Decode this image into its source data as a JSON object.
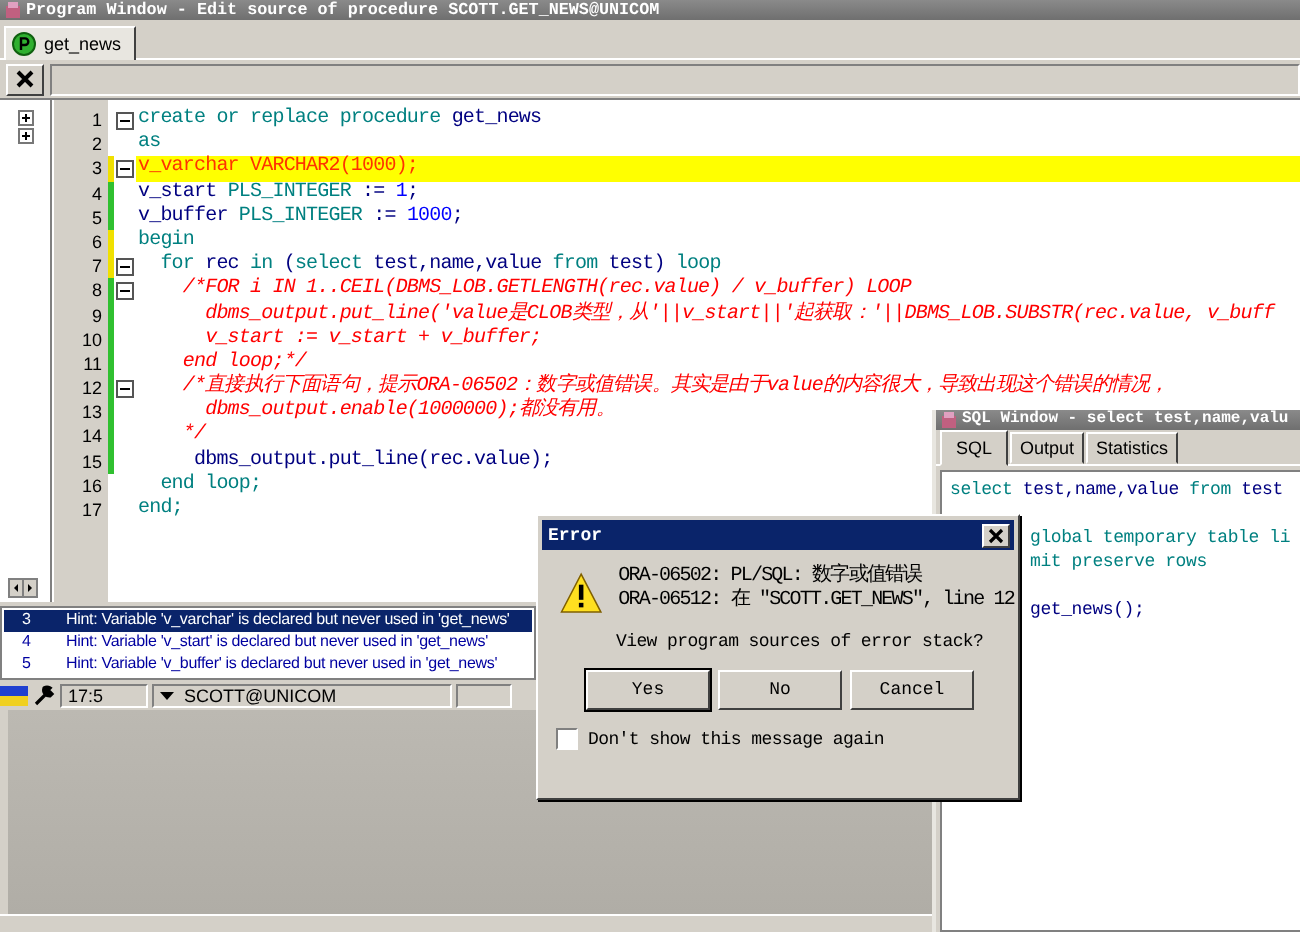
{
  "program_window": {
    "title": "Program Window - Edit source of procedure SCOTT.GET_NEWS@UNICOM",
    "tabs": [
      {
        "label": "get_news",
        "selected": true
      }
    ],
    "editor": {
      "lines": [
        {
          "number": "1",
          "foldable": true,
          "highlighted": false,
          "segments": [
            {
              "kind": "keyword",
              "text": "create or replace procedure "
            },
            {
              "kind": "name",
              "text": "get_news"
            }
          ]
        },
        {
          "number": "2",
          "highlighted": false,
          "segments": [
            {
              "kind": "keyword",
              "text": "as"
            }
          ]
        },
        {
          "number": "3",
          "color": "#f0e000",
          "foldable": true,
          "highlighted": true,
          "segments": [
            {
              "kind": "error",
              "text": "v_varchar VARCHAR2(1000);"
            }
          ]
        },
        {
          "number": "4",
          "color": "#30c030",
          "highlighted": false,
          "segments": [
            {
              "kind": "name",
              "text": "v_start "
            },
            {
              "kind": "keyword",
              "text": "PLS_INTEGER"
            },
            {
              "kind": "name",
              "text": " := "
            },
            {
              "kind": "number",
              "text": "1"
            },
            {
              "kind": "name",
              "text": ";"
            }
          ]
        },
        {
          "number": "5",
          "color": "#30c030",
          "highlighted": false,
          "segments": [
            {
              "kind": "name",
              "text": "v_buffer "
            },
            {
              "kind": "keyword",
              "text": "PLS_INTEGER"
            },
            {
              "kind": "name",
              "text": " := "
            },
            {
              "kind": "number",
              "text": "1000"
            },
            {
              "kind": "name",
              "text": ";"
            }
          ]
        },
        {
          "number": "6",
          "color": "#f0e000",
          "highlighted": false,
          "segments": [
            {
              "kind": "keyword",
              "text": "begin"
            }
          ]
        },
        {
          "number": "7",
          "color": "#f0e000",
          "foldable": true,
          "highlighted": false,
          "segments": [
            {
              "kind": "keyword",
              "text": "  for "
            },
            {
              "kind": "name",
              "text": "rec "
            },
            {
              "kind": "keyword",
              "text": "in "
            },
            {
              "kind": "name",
              "text": "("
            },
            {
              "kind": "keyword",
              "text": "select "
            },
            {
              "kind": "name",
              "text": "test,name,value "
            },
            {
              "kind": "keyword",
              "text": "from "
            },
            {
              "kind": "name",
              "text": "test) "
            },
            {
              "kind": "keyword",
              "text": "loop"
            }
          ]
        },
        {
          "number": "8",
          "color": "#30c030",
          "foldable": true,
          "highlighted": false,
          "segments": [
            {
              "kind": "comment",
              "text": "    /*FOR i IN 1..CEIL(DBMS_LOB.GETLENGTH(rec.value) / v_buffer) LOOP"
            }
          ]
        },
        {
          "number": "9",
          "color": "#30c030",
          "highlighted": false,
          "segments": [
            {
              "kind": "comment",
              "text": "      dbms_output.put_line('value是CLOB类型，从'||v_start||'起获取：'||DBMS_LOB.SUBSTR(rec.value, v_buff"
            }
          ]
        },
        {
          "number": "10",
          "color": "#30c030",
          "highlighted": false,
          "segments": [
            {
              "kind": "comment",
              "text": "      v_start := v_start + v_buffer;"
            }
          ]
        },
        {
          "number": "11",
          "color": "#30c030",
          "highlighted": false,
          "segments": [
            {
              "kind": "comment",
              "text": "    end loop;*/"
            }
          ]
        },
        {
          "number": "12",
          "color": "#30c030",
          "foldable": true,
          "highlighted": false,
          "segments": [
            {
              "kind": "comment",
              "text": "    /*直接执行下面语句，提示ORA-06502：数字或值错误。其实是由于value的内容很大，导致出现这个错误的情况，"
            }
          ]
        },
        {
          "number": "13",
          "color": "#30c030",
          "highlighted": false,
          "segments": [
            {
              "kind": "comment",
              "text": "      dbms_output.enable(1000000);都没有用。"
            }
          ]
        },
        {
          "number": "14",
          "color": "#30c030",
          "highlighted": false,
          "segments": [
            {
              "kind": "comment",
              "text": "    */"
            }
          ]
        },
        {
          "number": "15",
          "color": "#30c030",
          "highlighted": false,
          "segments": [
            {
              "kind": "name",
              "text": "     dbms_output.put_line(rec.value);"
            }
          ]
        },
        {
          "number": "16",
          "highlighted": false,
          "segments": [
            {
              "kind": "keyword",
              "text": "  end loop;"
            }
          ]
        },
        {
          "number": "17",
          "highlighted": false,
          "segments": [
            {
              "kind": "keyword",
              "text": "end;"
            }
          ]
        }
      ]
    },
    "hints": [
      {
        "line": "3",
        "text": "Hint: Variable 'v_varchar' is declared but never used in 'get_news'",
        "selected": true
      },
      {
        "line": "4",
        "text": "Hint: Variable 'v_start' is declared but never used in 'get_news'",
        "selected": false
      },
      {
        "line": "5",
        "text": "Hint: Variable 'v_buffer' is declared but never used in 'get_news'",
        "selected": false
      }
    ],
    "status_bar": {
      "position": "17:5",
      "connection": "SCOTT@UNICOM"
    }
  },
  "sql_window": {
    "title": "SQL Window - select test,name,valu",
    "tabs": [
      {
        "label": "SQL",
        "selected": true
      },
      {
        "label": "Output",
        "selected": false
      },
      {
        "label": "Statistics",
        "selected": false
      }
    ],
    "lines": [
      {
        "space_before": false,
        "partly_hidden": false,
        "segments": [
          {
            "kind": "keyword",
            "text": "select "
          },
          {
            "kind": "name",
            "text": "test,name,value "
          },
          {
            "kind": "keyword",
            "text": "from "
          },
          {
            "kind": "name",
            "text": "test"
          }
        ]
      },
      {
        "space_before": true,
        "partly_hidden": true,
        "segments": [
          {
            "kind": "keyword",
            "text": "global temporary table li"
          }
        ]
      },
      {
        "space_before": false,
        "partly_hidden": true,
        "segments": [
          {
            "kind": "keyword",
            "text": "mit preserve rows"
          }
        ]
      },
      {
        "space_before": true,
        "partly_hidden": true,
        "segments": [
          {
            "kind": "name",
            "text": "get_news();"
          }
        ]
      }
    ]
  },
  "error_dialog": {
    "title": "Error",
    "messages": [
      "ORA-06502: PL/SQL: 数字或值错误",
      "ORA-06512: 在 \"SCOTT.GET_NEWS\", line 12"
    ],
    "question": "View program sources of error stack?",
    "buttons": [
      {
        "label": "Yes",
        "default": true
      },
      {
        "label": "No",
        "default": false
      },
      {
        "label": "Cancel",
        "default": false
      }
    ],
    "checkbox": {
      "label": "Don't show this message again",
      "checked": false
    }
  }
}
